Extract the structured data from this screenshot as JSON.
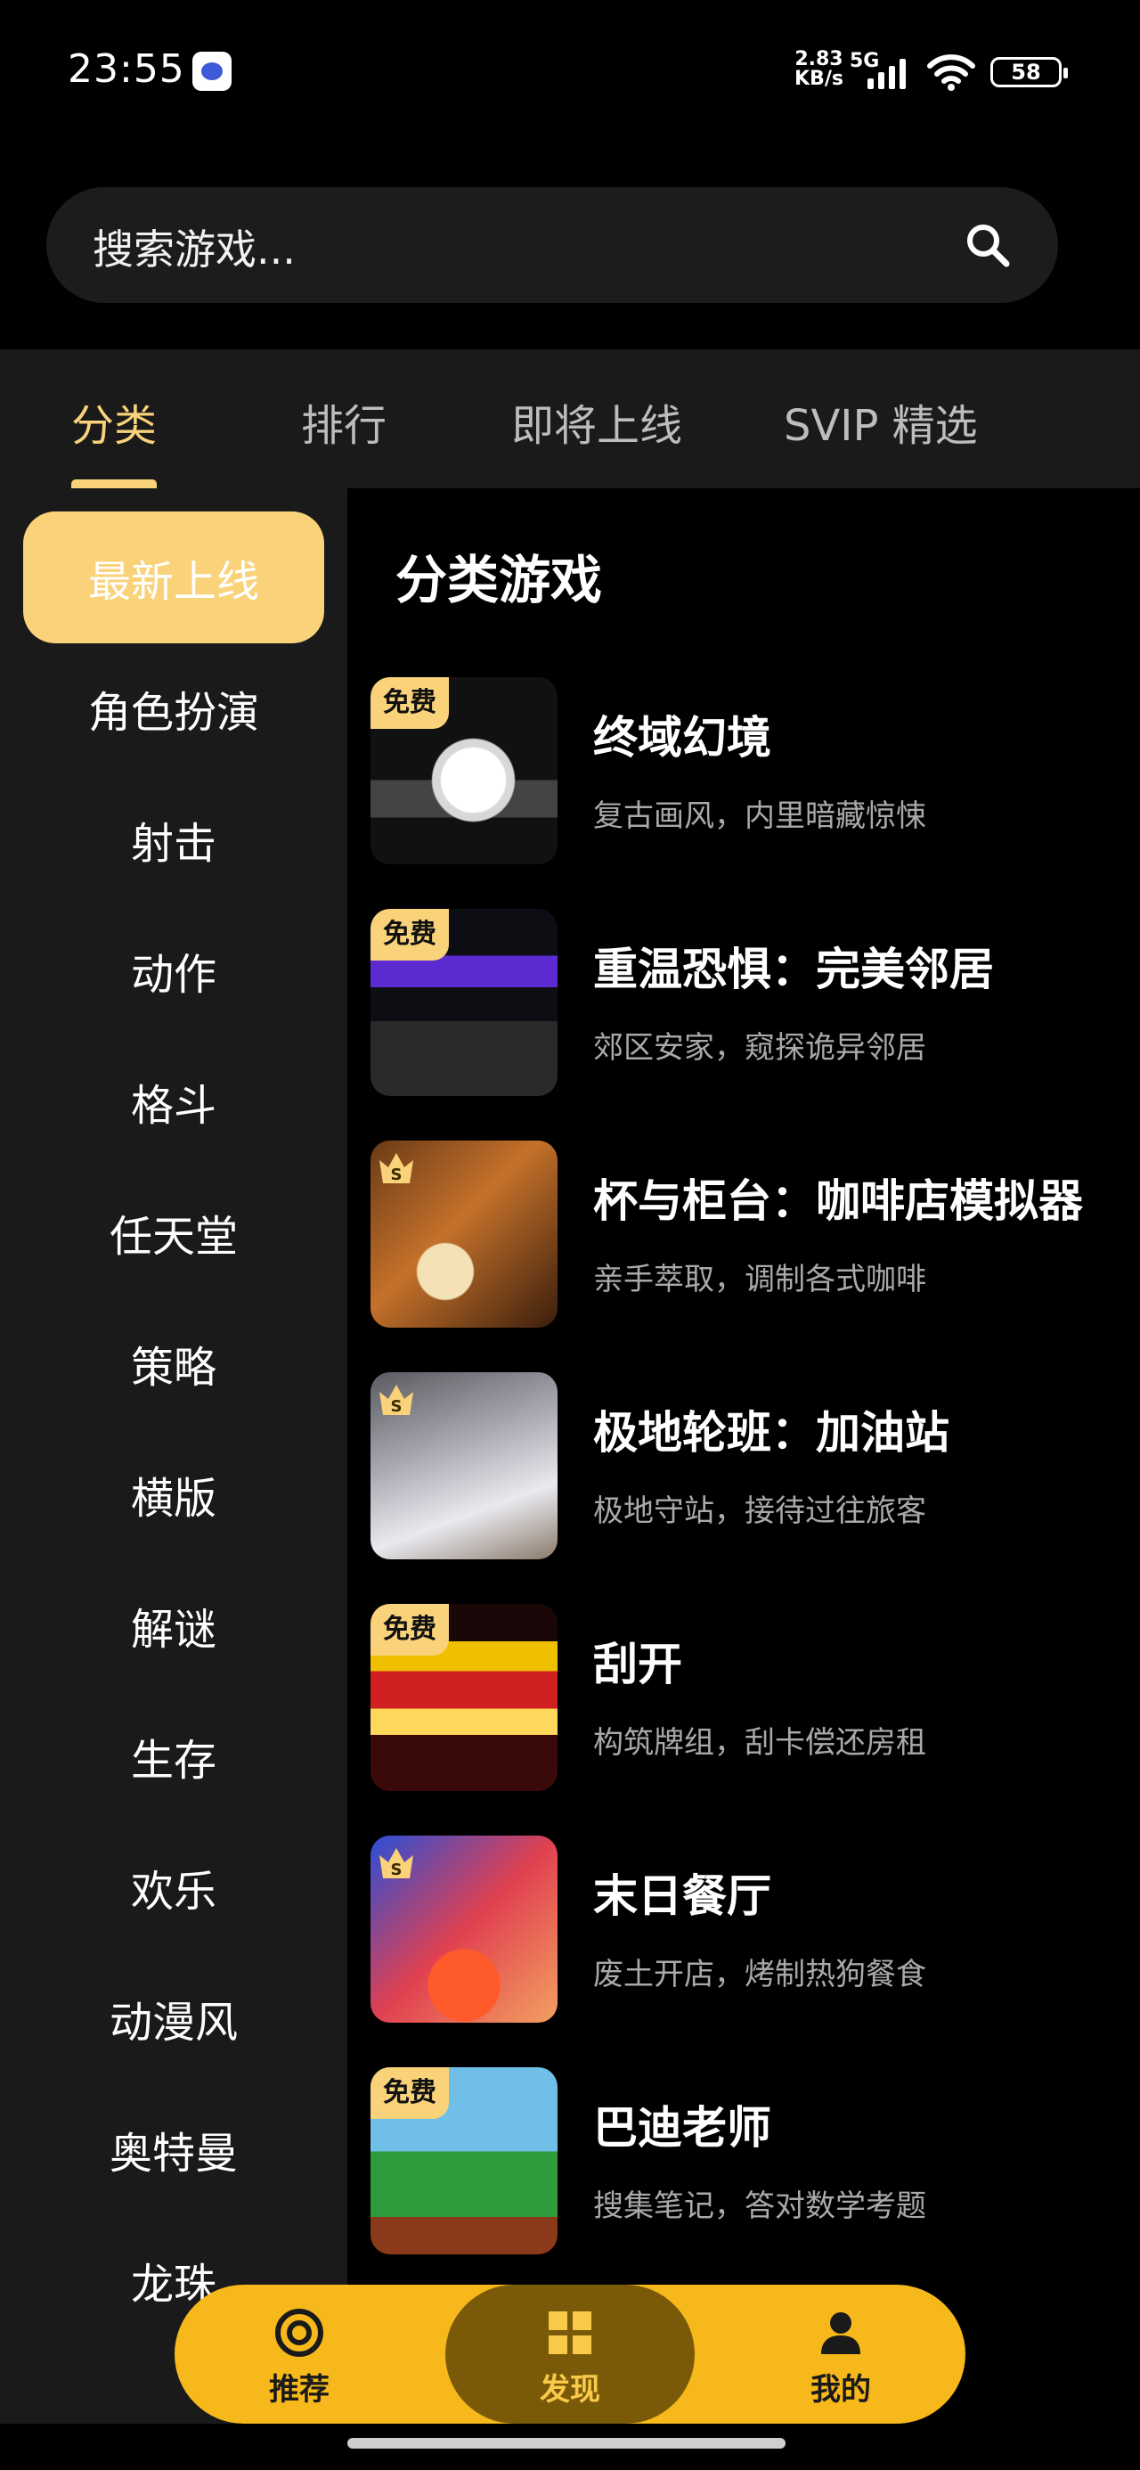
{
  "status": {
    "time": "23:55",
    "speed_value": "2.83",
    "speed_unit": "KB/s",
    "network": "5G",
    "battery": "58"
  },
  "search": {
    "placeholder": "搜索游戏..."
  },
  "tabs": [
    {
      "label": "分类"
    },
    {
      "label": "排行"
    },
    {
      "label": "即将上线"
    },
    {
      "label": "SVIP 精选"
    }
  ],
  "sidebar": {
    "items": [
      {
        "label": "最新上线"
      },
      {
        "label": "角色扮演"
      },
      {
        "label": "射击"
      },
      {
        "label": "动作"
      },
      {
        "label": "格斗"
      },
      {
        "label": "任天堂"
      },
      {
        "label": "策略"
      },
      {
        "label": "横版"
      },
      {
        "label": "解谜"
      },
      {
        "label": "生存"
      },
      {
        "label": "欢乐"
      },
      {
        "label": "动漫风"
      },
      {
        "label": "奥特曼"
      },
      {
        "label": "龙珠"
      }
    ]
  },
  "content": {
    "title": "分类游戏",
    "games": [
      {
        "title": "终域幻境",
        "desc": "复古画风，内里暗藏惊悚",
        "badge": "免费"
      },
      {
        "title": "重温恐惧：完美邻居",
        "desc": "郊区安家，窥探诡异邻居",
        "badge": "免费"
      },
      {
        "title": "杯与柜台：咖啡店模拟器",
        "desc": "亲手萃取，调制各式咖啡",
        "badge": "S"
      },
      {
        "title": "极地轮班：加油站",
        "desc": "极地守站，接待过往旅客",
        "badge": "S"
      },
      {
        "title": "刮开",
        "desc": "构筑牌组，刮卡偿还房租",
        "badge": "免费"
      },
      {
        "title": "末日餐厅",
        "desc": "废土开店，烤制热狗餐食",
        "badge": "S"
      },
      {
        "title": "巴迪老师",
        "desc": "搜集笔记，答对数学考题",
        "badge": "免费"
      }
    ]
  },
  "bottom_nav": [
    {
      "label": "推荐",
      "icon": "target-icon"
    },
    {
      "label": "发现",
      "icon": "grid-icon"
    },
    {
      "label": "我的",
      "icon": "user-icon"
    }
  ],
  "colors": {
    "accent": "#f9d27a",
    "nav_bg": "#f7b81c",
    "nav_active": "#7a5a08"
  }
}
